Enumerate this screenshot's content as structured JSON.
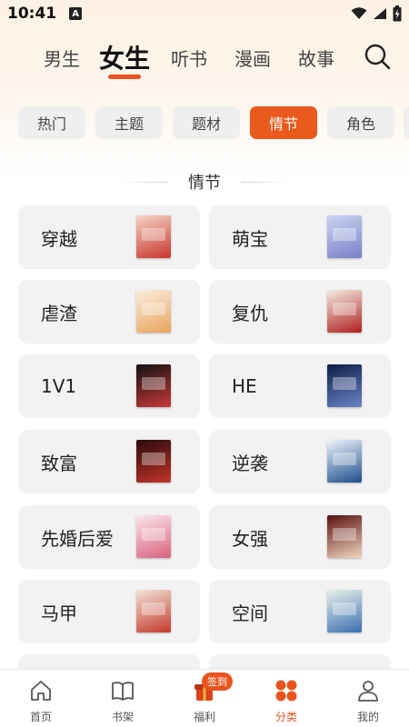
{
  "status_bar": {
    "time": "10:41",
    "indicator": "A"
  },
  "top_tabs": [
    {
      "label": "男生",
      "active": false
    },
    {
      "label": "女生",
      "active": true
    },
    {
      "label": "听书",
      "active": false
    },
    {
      "label": "漫画",
      "active": false
    },
    {
      "label": "故事",
      "active": false
    }
  ],
  "filter_chips": [
    {
      "label": "热门",
      "active": false
    },
    {
      "label": "主题",
      "active": false
    },
    {
      "label": "题材",
      "active": false
    },
    {
      "label": "情节",
      "active": true
    },
    {
      "label": "角色",
      "active": false
    }
  ],
  "section_title": "情节",
  "categories": [
    {
      "label": "穿越",
      "cover_colors": [
        "#f6d6c8",
        "#c7352b"
      ]
    },
    {
      "label": "萌宝",
      "cover_colors": [
        "#c9d6f3",
        "#7a7fc7"
      ]
    },
    {
      "label": "虐渣",
      "cover_colors": [
        "#fbeee0",
        "#e8a45c"
      ]
    },
    {
      "label": "复仇",
      "cover_colors": [
        "#f3ece2",
        "#b0201e"
      ]
    },
    {
      "label": "1V1",
      "cover_colors": [
        "#121212",
        "#c8383a"
      ]
    },
    {
      "label": "HE",
      "cover_colors": [
        "#0d1d45",
        "#6a86c9"
      ]
    },
    {
      "label": "致富",
      "cover_colors": [
        "#2a0b0b",
        "#c23428"
      ]
    },
    {
      "label": "逆袭",
      "cover_colors": [
        "#eef4fb",
        "#1c4f8c"
      ]
    },
    {
      "label": "先婚后爱",
      "cover_colors": [
        "#fbe6ec",
        "#d8627f"
      ]
    },
    {
      "label": "女强",
      "cover_colors": [
        "#5a1010",
        "#f0d8c0"
      ]
    },
    {
      "label": "马甲",
      "cover_colors": [
        "#f3e3d8",
        "#c43b2d"
      ]
    },
    {
      "label": "空间",
      "cover_colors": [
        "#eaf1ea",
        "#3a6fb0"
      ]
    },
    {
      "label": "",
      "cover_colors": [
        "#f2f2f2",
        "#f2f2f2"
      ]
    },
    {
      "label": "",
      "cover_colors": [
        "#f2f2f2",
        "#f2f2f2"
      ]
    }
  ],
  "bottom_nav": [
    {
      "label": "首页",
      "icon": "home-icon",
      "active": false
    },
    {
      "label": "书架",
      "icon": "bookshelf-icon",
      "active": false
    },
    {
      "label": "福利",
      "icon": "gift-icon",
      "active": false
    },
    {
      "label": "分类",
      "icon": "category-icon",
      "active": true
    },
    {
      "label": "我的",
      "icon": "profile-icon",
      "active": false
    }
  ],
  "checkin_badge": "签到",
  "colors": {
    "accent": "#e8541e",
    "card_bg": "#f2f2f2",
    "chip_bg": "#efefef"
  }
}
